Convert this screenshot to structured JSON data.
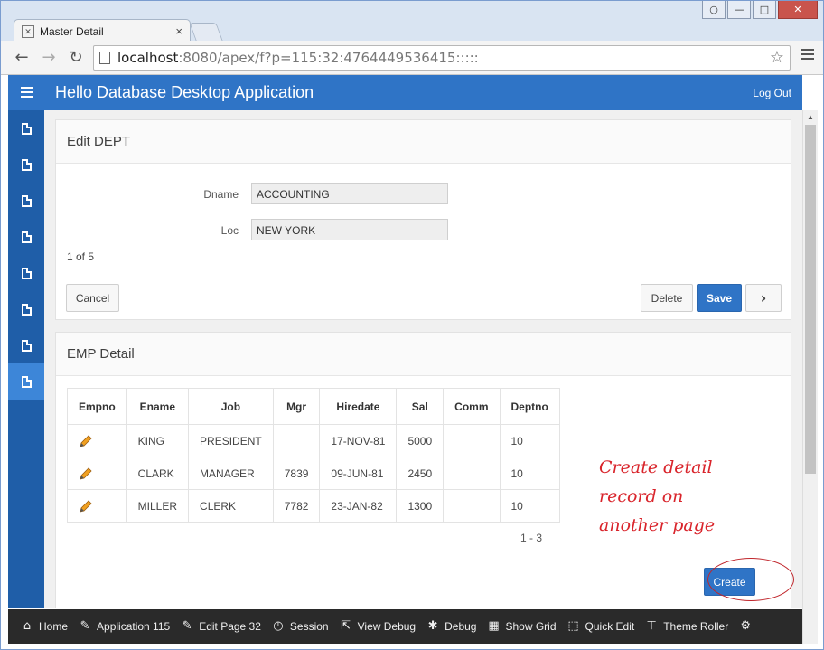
{
  "browser": {
    "tab_title": "Master Detail",
    "tab_close": "×",
    "url_host": "localhost",
    "url_rest": ":8080/apex/f?p=115:32:4764449536415:::::",
    "window_controls": [
      "○",
      "—",
      "□",
      "✕"
    ]
  },
  "app": {
    "title": "Hello Database Desktop Application",
    "logout": "Log Out"
  },
  "sidenav": {
    "items": [
      "page-1",
      "page-2",
      "page-3",
      "page-4",
      "page-5",
      "page-6",
      "page-7",
      "page-8"
    ],
    "active_index": 7
  },
  "edit_region": {
    "title": "Edit DEPT",
    "dname_label": "Dname",
    "dname_value": "ACCOUNTING",
    "loc_label": "Loc",
    "loc_value": "NEW YORK",
    "counter": "1 of 5",
    "cancel": "Cancel",
    "delete": "Delete",
    "save": "Save"
  },
  "emp_region": {
    "title": "EMP Detail",
    "columns": [
      "Empno",
      "Ename",
      "Job",
      "Mgr",
      "Hiredate",
      "Sal",
      "Comm",
      "Deptno"
    ],
    "rows": [
      {
        "ename": "KING",
        "job": "PRESIDENT",
        "mgr": "",
        "hiredate": "17-NOV-81",
        "sal": "5000",
        "comm": "",
        "deptno": "10"
      },
      {
        "ename": "CLARK",
        "job": "MANAGER",
        "mgr": "7839",
        "hiredate": "09-JUN-81",
        "sal": "2450",
        "comm": "",
        "deptno": "10"
      },
      {
        "ename": "MILLER",
        "job": "CLERK",
        "mgr": "7782",
        "hiredate": "23-JAN-82",
        "sal": "1300",
        "comm": "",
        "deptno": "10"
      }
    ],
    "pagination": "1 - 3",
    "create": "Create"
  },
  "annotation": {
    "line1": "Create detail",
    "line2": "record on",
    "line3": "another page",
    "color": "#d9242b"
  },
  "devbar": {
    "home": "Home",
    "application": "Application 115",
    "edit_page": "Edit Page 32",
    "session": "Session",
    "view_debug": "View Debug",
    "debug": "Debug",
    "show_grid": "Show Grid",
    "quick_edit": "Quick Edit",
    "theme_roller": "Theme Roller"
  }
}
